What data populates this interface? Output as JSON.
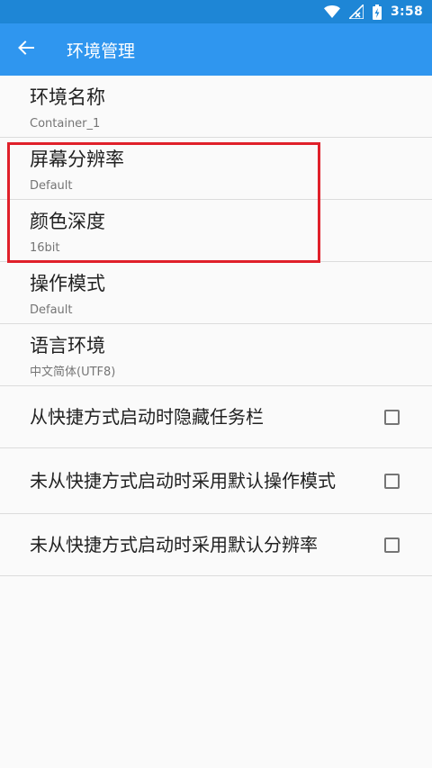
{
  "status_bar": {
    "time": "3:58",
    "icons": [
      "wifi-icon",
      "signal-off-icon",
      "battery-charging-icon"
    ]
  },
  "app_bar": {
    "back_icon": "arrow-left-icon",
    "title": "环境管理"
  },
  "settings": [
    {
      "title": "环境名称",
      "summary": "Container_1"
    },
    {
      "title": "屏幕分辨率",
      "summary": "Default"
    },
    {
      "title": "颜色深度",
      "summary": "16bit"
    },
    {
      "title": "操作模式",
      "summary": "Default"
    },
    {
      "title": "语言环境",
      "summary": "中文简体(UTF8)"
    }
  ],
  "checkbox_settings": [
    {
      "title": "从快捷方式启动时隐藏任务栏",
      "checked": false
    },
    {
      "title": "未从快捷方式启动时采用默认操作模式",
      "checked": false
    },
    {
      "title": "未从快捷方式启动时采用默认分辨率",
      "checked": false
    }
  ],
  "colors": {
    "status_bar": "#1e86d6",
    "app_bar": "#2f96ef",
    "highlight": "#e0202a"
  }
}
